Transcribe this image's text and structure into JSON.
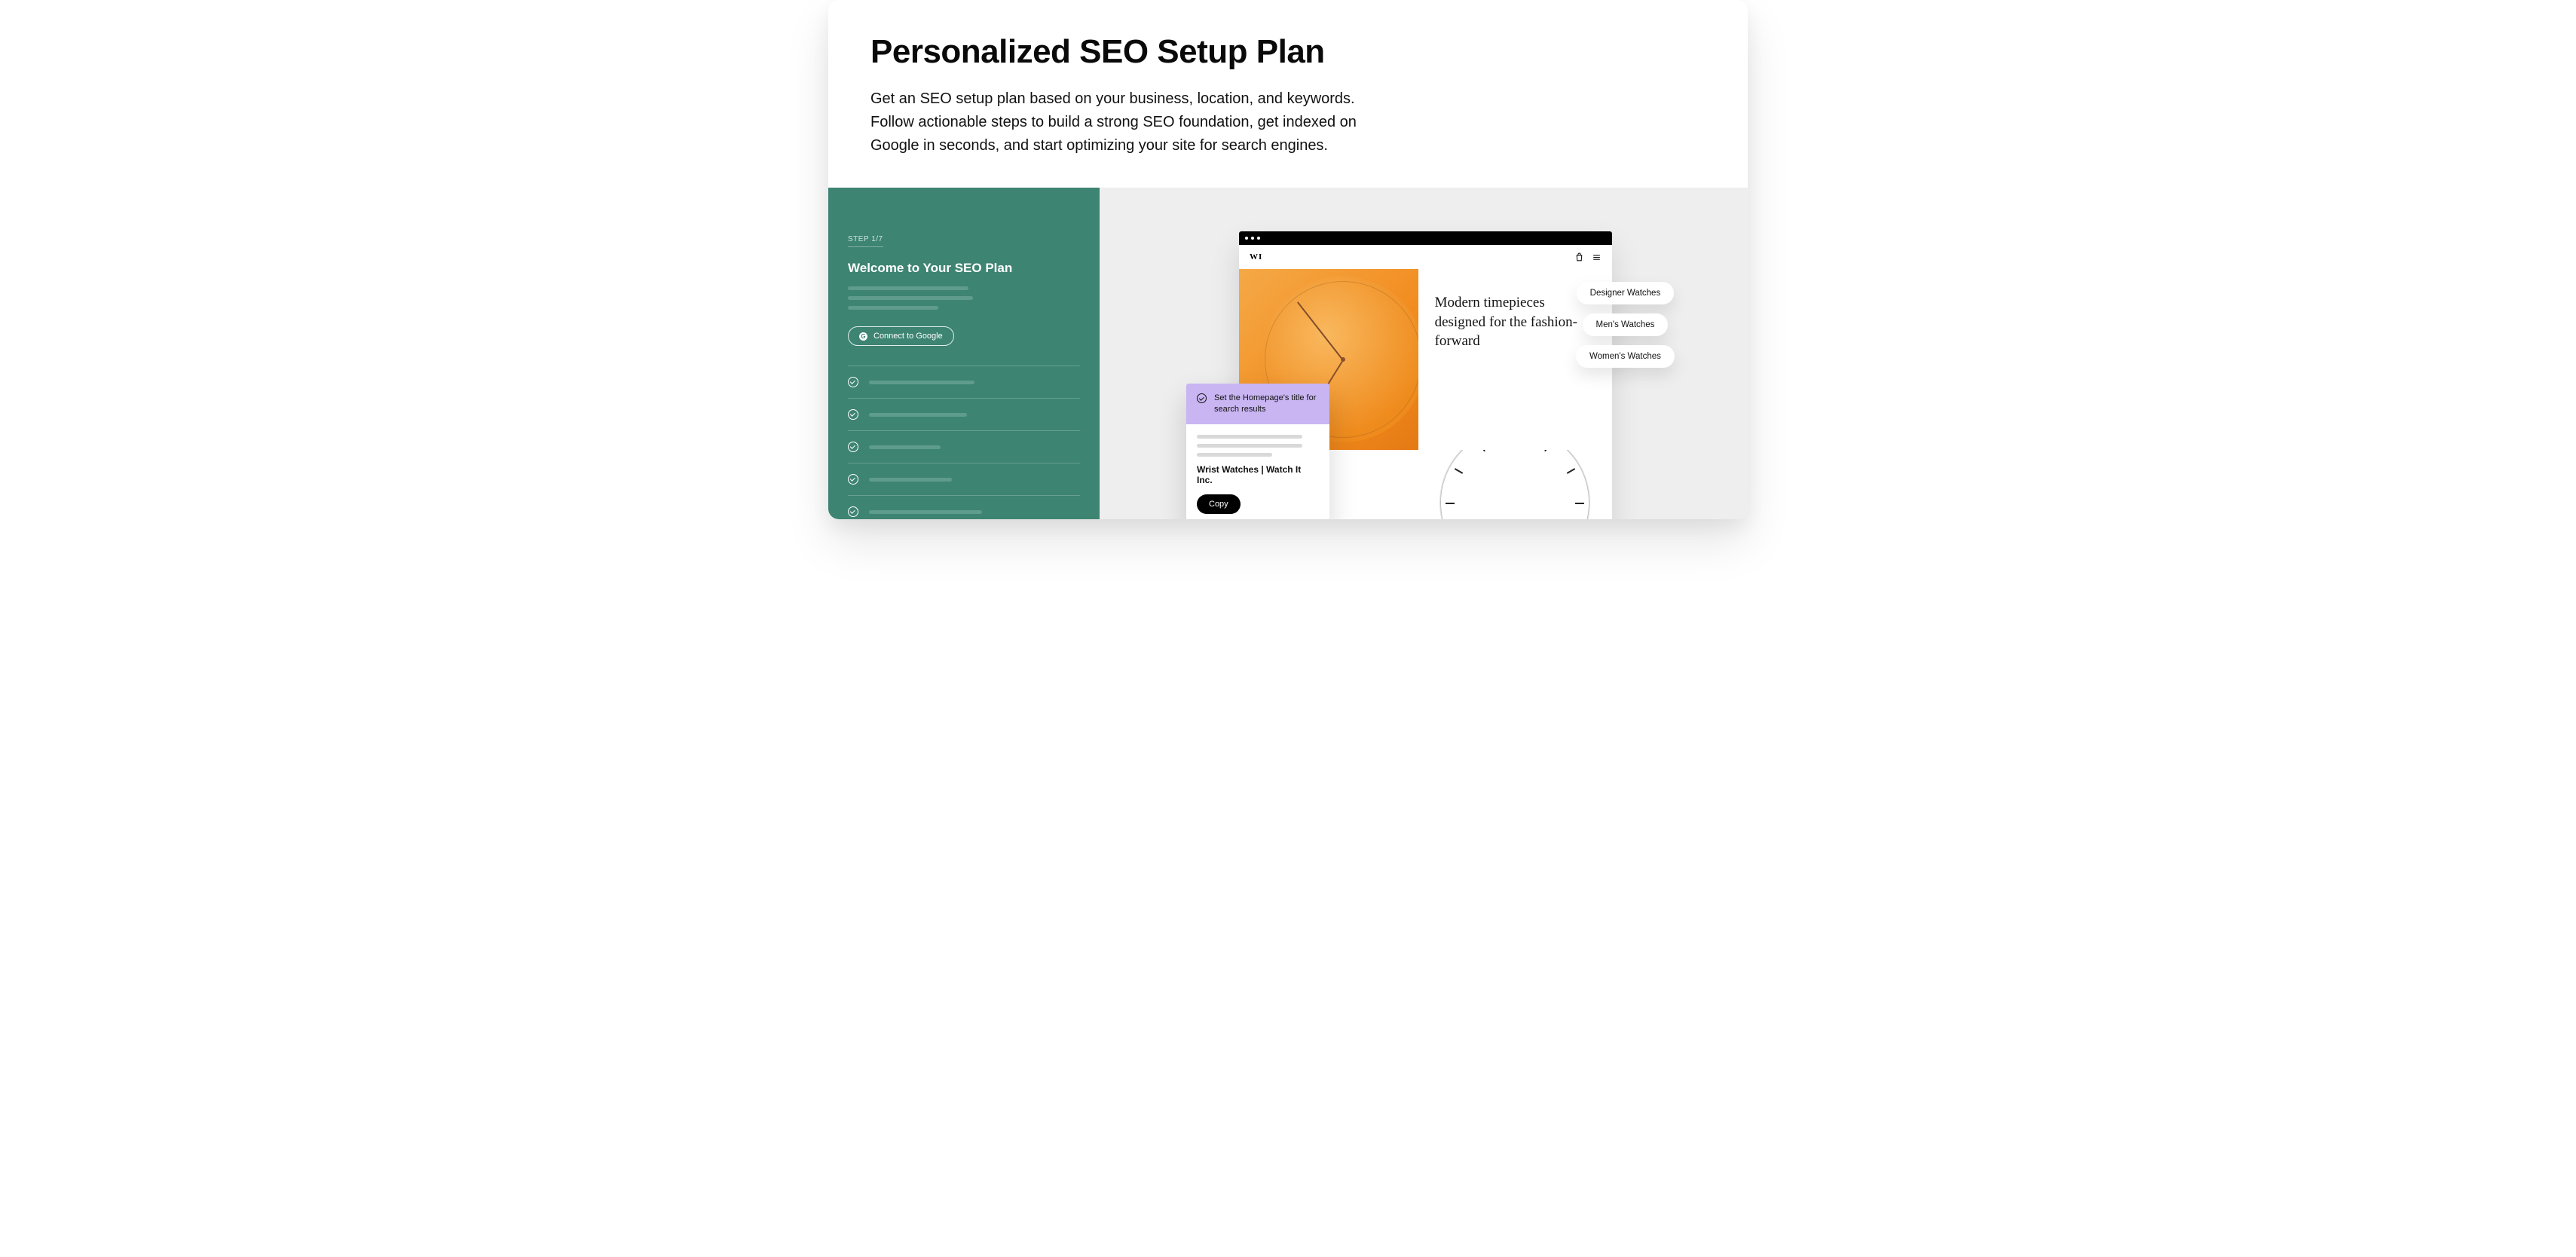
{
  "title": "Personalized SEO Setup Plan",
  "description": "Get an SEO setup plan based on your business, location, and keywords. Follow actionable steps to build a strong SEO foundation, get indexed on Google in seconds, and start optimizing your site for search engines.",
  "seo_panel": {
    "step_label": "STEP 1/7",
    "heading": "Welcome to Your SEO Plan",
    "connect_label": "Connect to Google",
    "google_g": "G"
  },
  "site": {
    "logo": "WI",
    "hero_text": "Modern timepieces designed for the fashion-forward"
  },
  "task": {
    "title": "Set the Homepage's title for search results",
    "result": "Wrist Watches | Watch It Inc.",
    "copy_label": "Copy"
  },
  "pills": [
    "Designer Watches",
    "Men's Watches",
    "Women's Watches"
  ]
}
